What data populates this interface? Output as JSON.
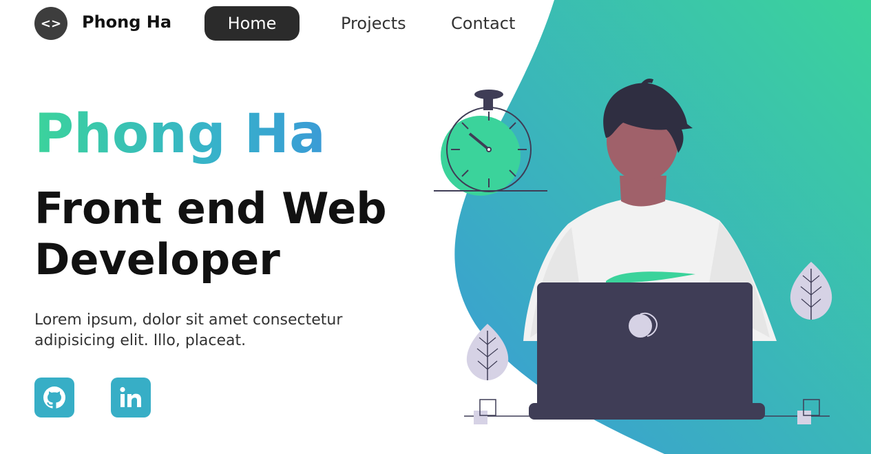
{
  "colors": {
    "gradient_start": "#3bd39b",
    "gradient_end": "#3a9bd6",
    "nav_active_bg": "#2b2b2b",
    "social_bg": "#37aec6",
    "laptop": "#3f3d56"
  },
  "nav": {
    "logo_symbol": "<>",
    "logo_icon": "code-brackets-icon",
    "brand": "Phong Ha",
    "links": [
      {
        "label": "Home",
        "active": true
      },
      {
        "label": "Projects",
        "active": false
      },
      {
        "label": "Contact",
        "active": false
      }
    ]
  },
  "hero": {
    "name": "Phong Ha",
    "title": "Front end Web Developer",
    "description": "Lorem ipsum, dolor sit amet consectetur adipisicing elit. Illo, placeat."
  },
  "social": [
    {
      "icon": "github-icon"
    },
    {
      "icon": "linkedin-icon"
    }
  ],
  "illustration": {
    "elements": [
      "stopwatch-icon",
      "person",
      "laptop",
      "plant-leaf-icon"
    ]
  }
}
